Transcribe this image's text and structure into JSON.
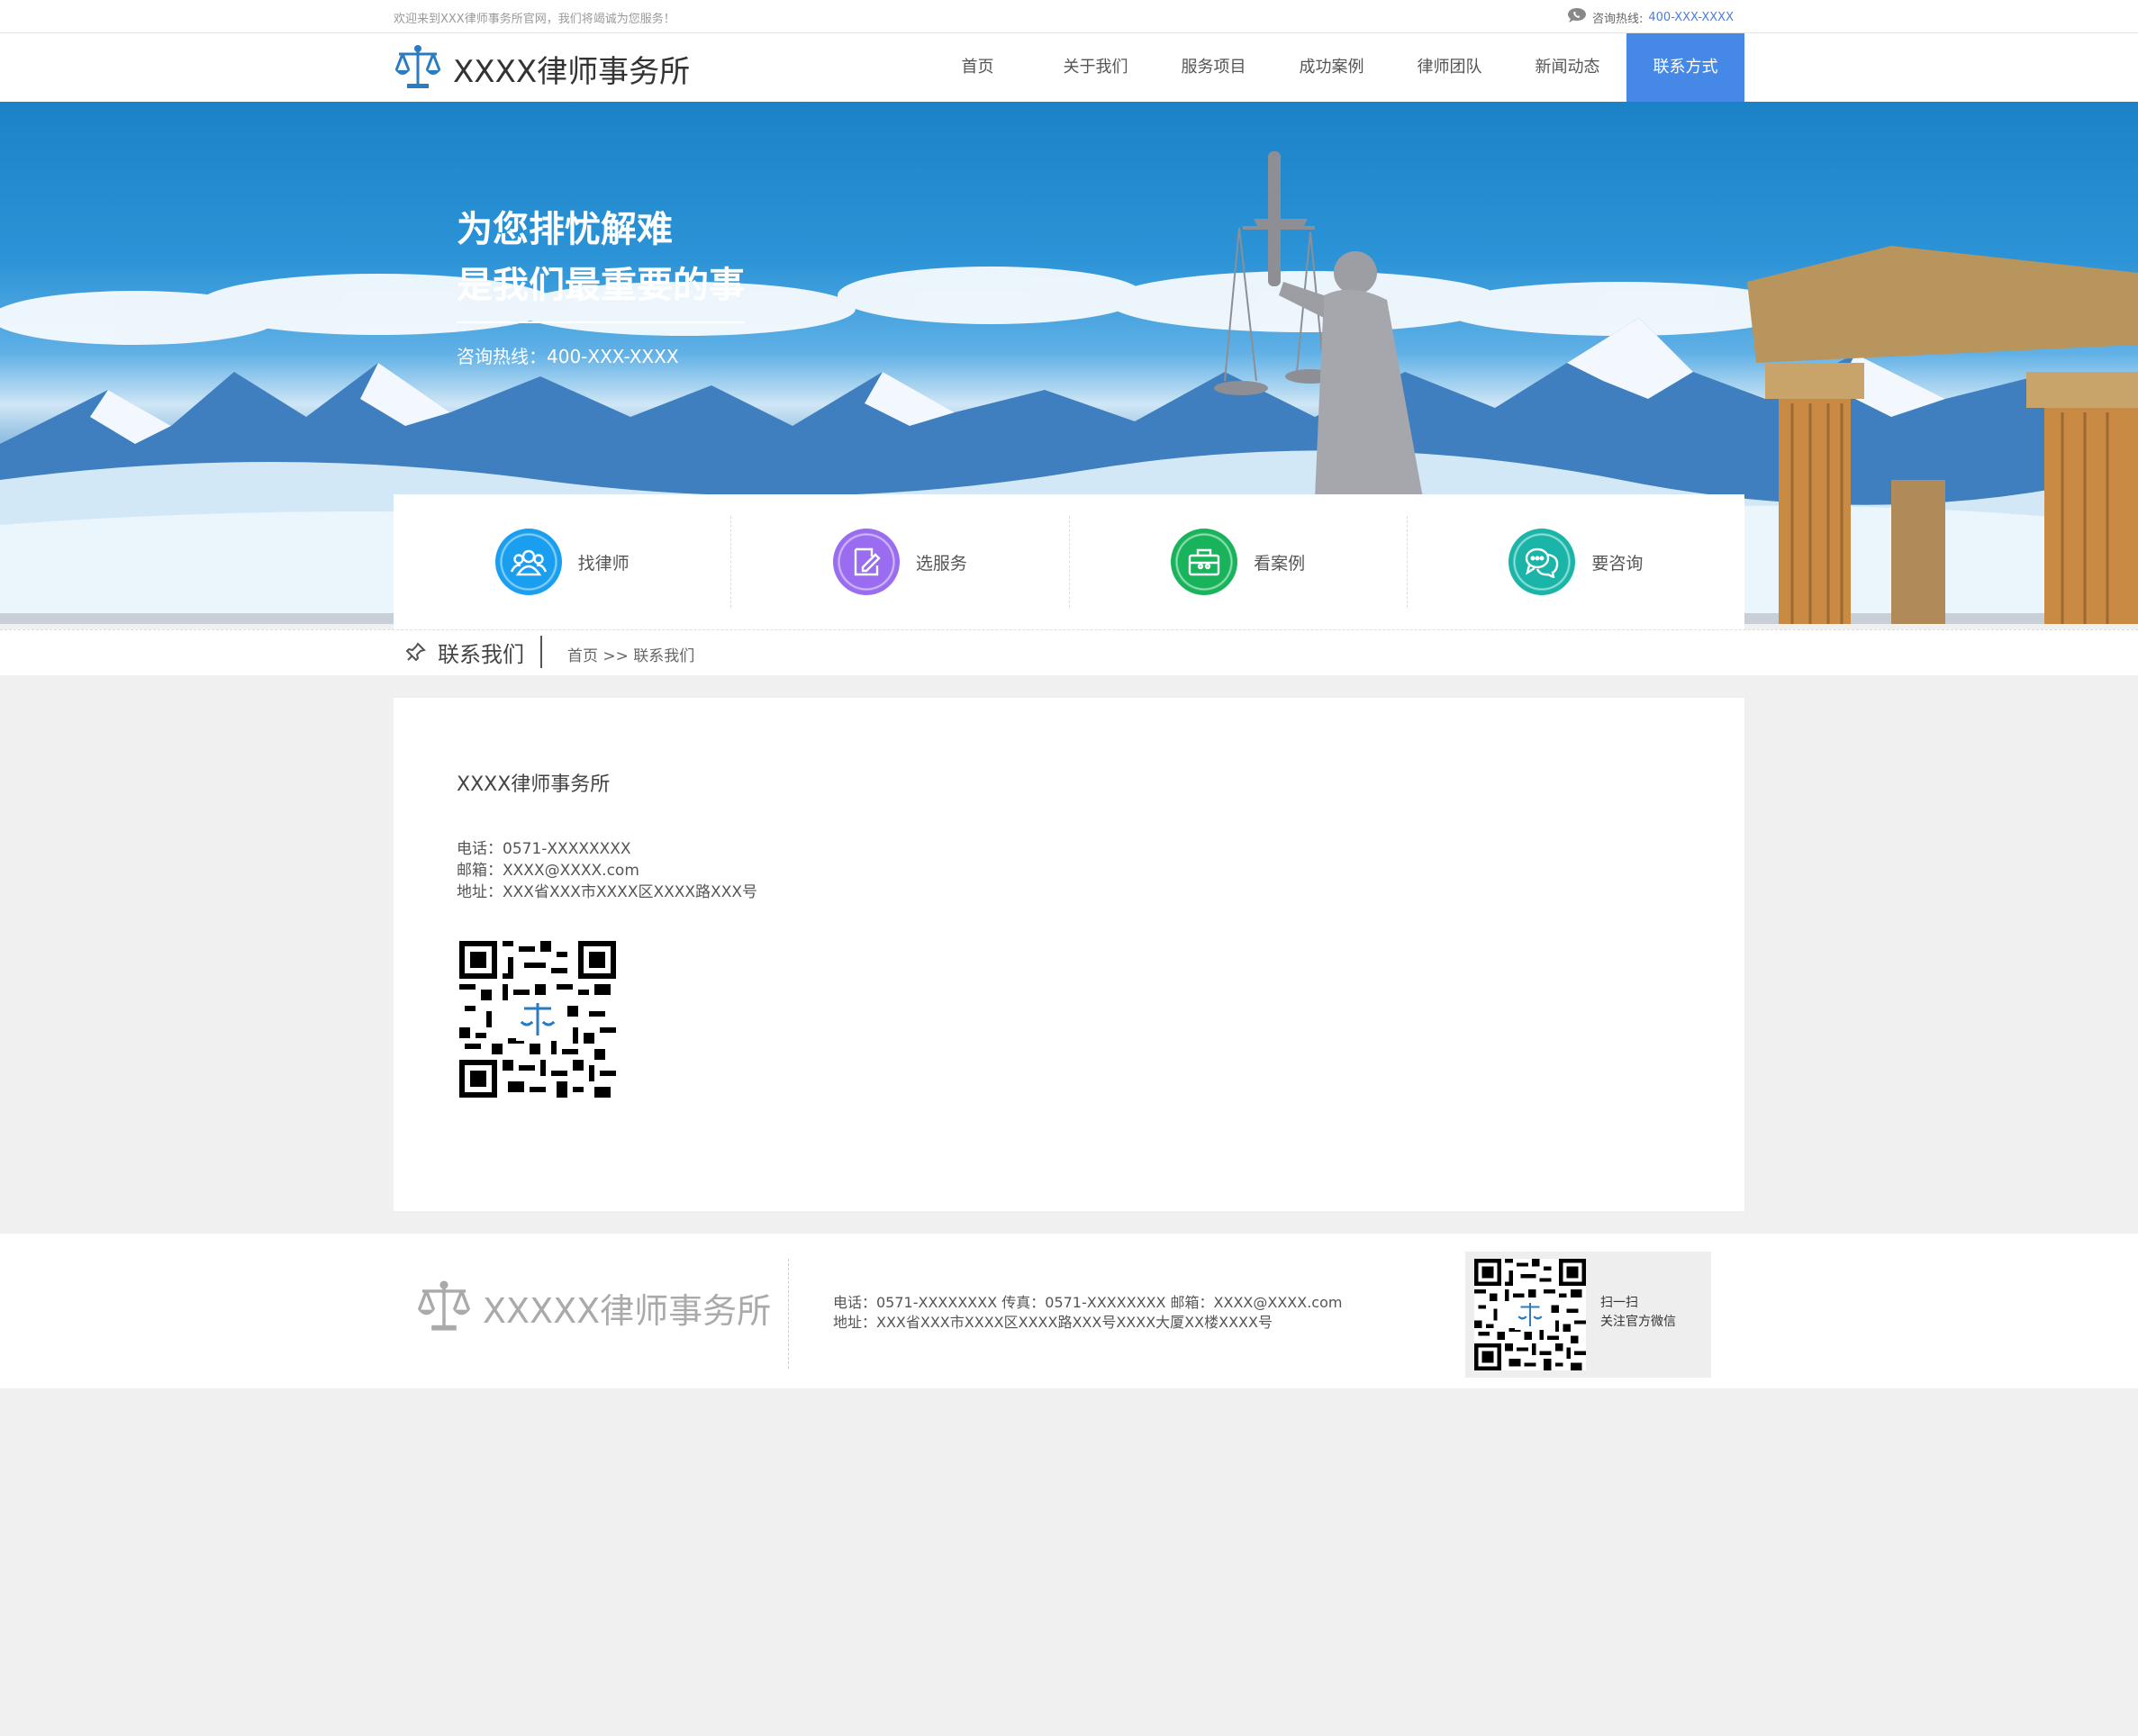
{
  "topbar": {
    "welcome": "欢迎来到XXX律师事务所官网，我们将竭诚为您服务！",
    "hotline_label": "咨询热线:",
    "hotline_number": "400-XXX-XXXX"
  },
  "header": {
    "logo_text": "XXXX律师事务所",
    "nav": [
      {
        "label": "首页"
      },
      {
        "label": "关于我们"
      },
      {
        "label": "服务项目"
      },
      {
        "label": "成功案例"
      },
      {
        "label": "律师团队"
      },
      {
        "label": "新闻动态"
      },
      {
        "label": "联系方式",
        "active": true
      }
    ]
  },
  "banner": {
    "slogan_line1": "为您排忧解难",
    "slogan_line2": "是我们最重要的事",
    "hotline": "咨询热线：400-XXX-XXXX"
  },
  "quick_links": [
    {
      "label": "找律师",
      "icon": "users-icon",
      "color": "#1a9ff0"
    },
    {
      "label": "选服务",
      "icon": "edit-document-icon",
      "color": "#9a6cf0"
    },
    {
      "label": "看案例",
      "icon": "folder-case-icon",
      "color": "#19b35b"
    },
    {
      "label": "要咨询",
      "icon": "chat-bubbles-icon",
      "color": "#1ab5a8"
    }
  ],
  "section": {
    "title": "联系我们",
    "breadcrumb": "首页 >> 联系我们"
  },
  "contact": {
    "firm_name": "XXXX律师事务所",
    "phone": "电话：0571-XXXXXXXX",
    "email": "邮箱：XXXX@XXXX.com",
    "address": "地址：XXX省XXX市XXXX区XXXX路XXX号"
  },
  "footer": {
    "logo_text": "XXXXX律师事务所",
    "line1": "电话：0571-XXXXXXXX 传真：0571-XXXXXXXX 邮箱：XXXX@XXXX.com",
    "line2": "地址：XXX省XXX市XXXX区XXXX路XXX号XXXX大厦XX楼XXXX号",
    "qr_line1": "扫一扫",
    "qr_line2": "关注官方微信"
  },
  "colors": {
    "accent": "#4688e6",
    "hotline": "#4d7ddb",
    "logo_blue": "#2a7bc0"
  }
}
